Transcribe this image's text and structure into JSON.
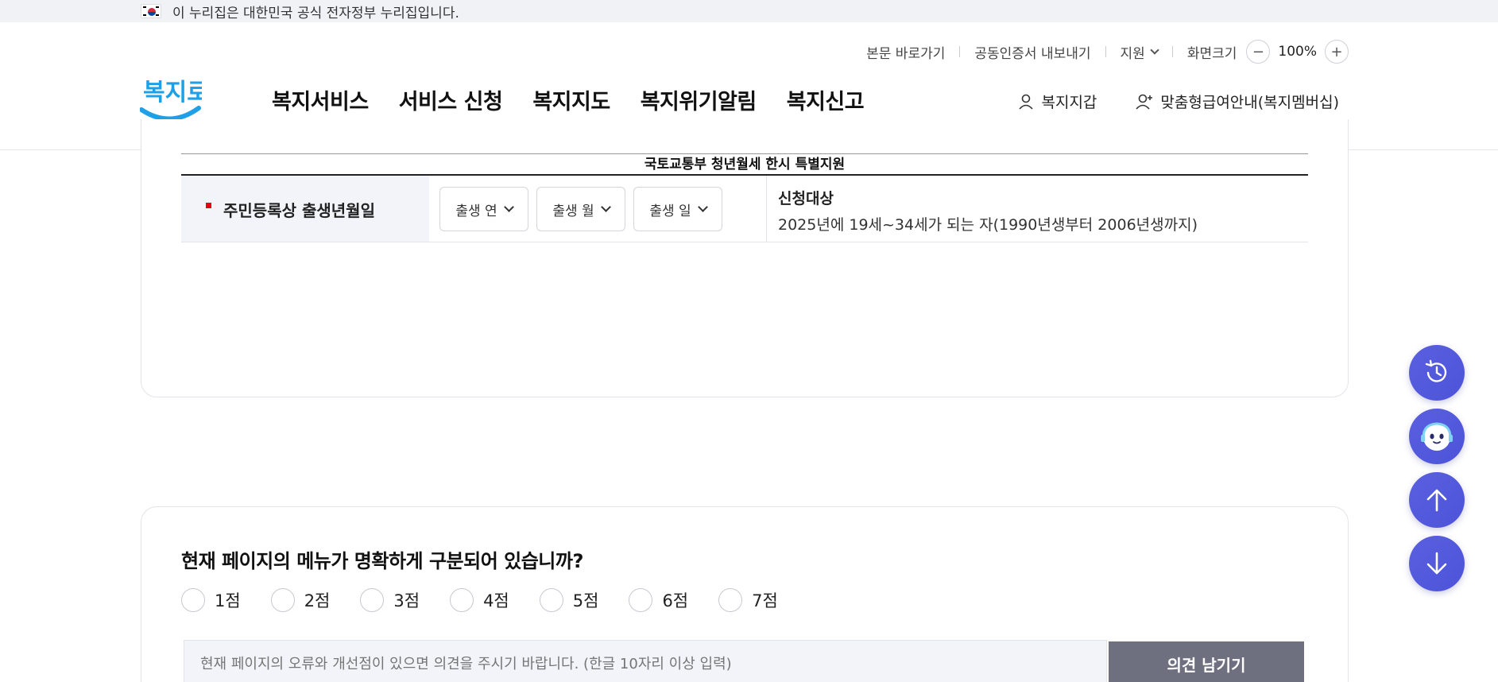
{
  "gov_banner": {
    "text": "이 누리집은 대한민국 공식 전자정부 누리집입니다."
  },
  "header": {
    "util": {
      "skip": "본문 바로가기",
      "cert": "공동인증서 내보내기",
      "support": "지원",
      "screen_size": "화면크기",
      "zoom": "100%",
      "minus": "−",
      "plus": "+"
    },
    "logo_text": "복지로",
    "gnb": [
      "복지서비스",
      "서비스 신청",
      "복지지도",
      "복지위기알림",
      "복지신고"
    ],
    "right": {
      "wallet": "복지지갑",
      "membership": "맞춤형급여안내(복지멤버십)"
    }
  },
  "info": {
    "table_title": "국토교통부 청년월세 한시 특별지원",
    "label": "주민등록상 출생년월일",
    "selects": [
      "출생 연",
      "출생 월",
      "출생 일"
    ],
    "target_title": "신청대상",
    "target_desc": "2025년에 19세~34세가 되는 자(1990년생부터 2006년생까지)"
  },
  "survey": {
    "question": "현재 페이지의 메뉴가 명확하게 구분되어 있습니까?",
    "scores": [
      "1점",
      "2점",
      "3점",
      "4점",
      "5점",
      "6점",
      "7점"
    ],
    "placeholder": "현재 페이지의 오류와 개선점이 있으면 의견을 주시기 바랍니다. (한글 10자리 이상 입력)",
    "submit": "의견 남기기"
  },
  "colors": {
    "accent": "#4d54d8",
    "required": "#e60012",
    "submit_bg": "#6e7080",
    "label_bg": "#f3f4fa"
  },
  "fab_icons": [
    "history-icon",
    "chatbot-icon",
    "arrow-up-icon",
    "arrow-down-icon"
  ]
}
